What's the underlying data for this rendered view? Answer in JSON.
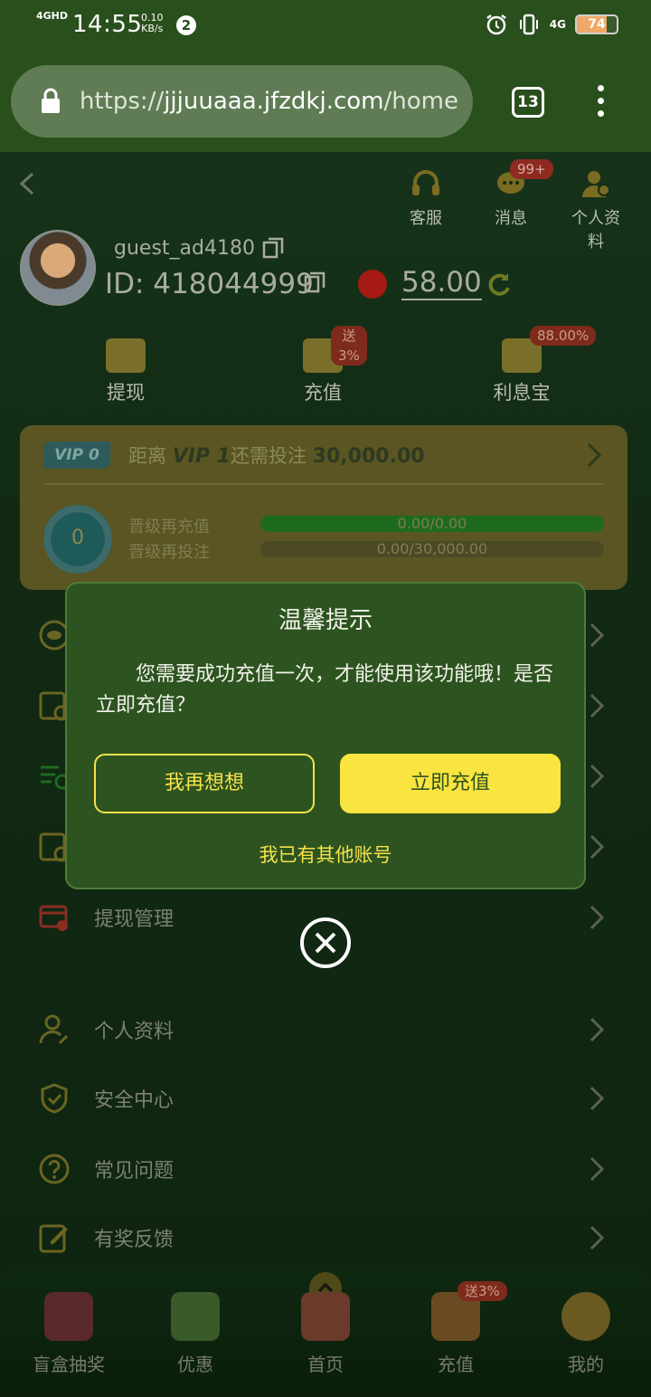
{
  "status_bar": {
    "network": "4GHD",
    "time": "14:55",
    "speed_value": "0.10",
    "speed_unit": "KB/s",
    "notification_count": "2",
    "right_network": "4G",
    "battery": "74"
  },
  "browser": {
    "url_prefix": "https://",
    "url_host": "jjjuuaaa.jfzdkj.com",
    "url_path": "/home/n",
    "tab_count": "13"
  },
  "header": {
    "service_label": "客服",
    "messages_label": "消息",
    "messages_badge": "99+",
    "profile_label": "个人资料"
  },
  "user": {
    "username": "guest_ad4180",
    "id_text": "ID: 418044999",
    "balance": "58.00"
  },
  "actions": {
    "withdraw_label": "提现",
    "recharge_label": "充值",
    "recharge_badge": "送3%",
    "interest_label": "利息宝",
    "interest_badge": "88.00%"
  },
  "vip": {
    "tag": "VIP 0",
    "prefix": "距离",
    "next_level": "VIP 1",
    "middle": "还需投注",
    "amount": "30,000.00",
    "medal_level": "0",
    "row1_label": "晋级再充值",
    "row1_progress": "0.00/0.00",
    "row1_fraction": 1.0,
    "row2_label": "晋级再投注",
    "row2_progress": "0.00/30,000.00",
    "row2_fraction": 0.0
  },
  "menu": {
    "withdraw_manage": "提现管理",
    "profile": "个人资料",
    "security": "安全中心",
    "faq": "常见问题",
    "feedback": "有奖反馈"
  },
  "bottom_nav": {
    "lottery": "盲盒抽奖",
    "offers": "优惠",
    "home": "首页",
    "recharge": "充值",
    "recharge_badge": "送3%",
    "mine": "我的"
  },
  "dialog": {
    "title": "温馨提示",
    "message": "您需要成功充值一次，才能使用该功能哦！是否立即充值？",
    "think_button": "我再想想",
    "recharge_button": "立即充值",
    "other_account": "我已有其他账号"
  }
}
